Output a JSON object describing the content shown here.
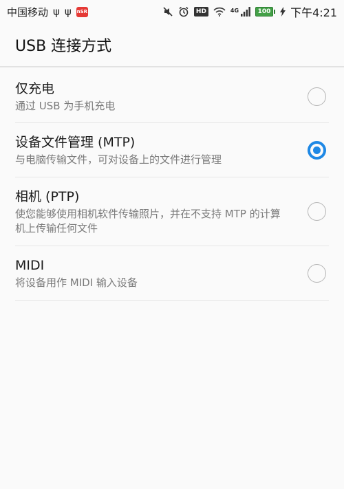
{
  "status_bar": {
    "carrier": "中国移动",
    "usb_icon": "ψ",
    "app_badge": "nSR",
    "hd": "HD",
    "network": "4G",
    "battery": "100",
    "time": "下午4:21"
  },
  "app_bar": {
    "title": "USB 连接方式"
  },
  "options": [
    {
      "title": "仅充电",
      "subtitle": "通过 USB 为手机充电",
      "selected": false
    },
    {
      "title": "设备文件管理 (MTP)",
      "subtitle": "与电脑传输文件，可对设备上的文件进行管理",
      "selected": true
    },
    {
      "title": "相机 (PTP)",
      "subtitle": "使您能够使用相机软件传输照片，并在不支持 MTP 的计算机上传输任何文件",
      "selected": false
    },
    {
      "title": "MIDI",
      "subtitle": "将设备用作 MIDI 输入设备",
      "selected": false
    }
  ],
  "colors": {
    "accent": "#1e88e5",
    "battery": "#43a047"
  }
}
